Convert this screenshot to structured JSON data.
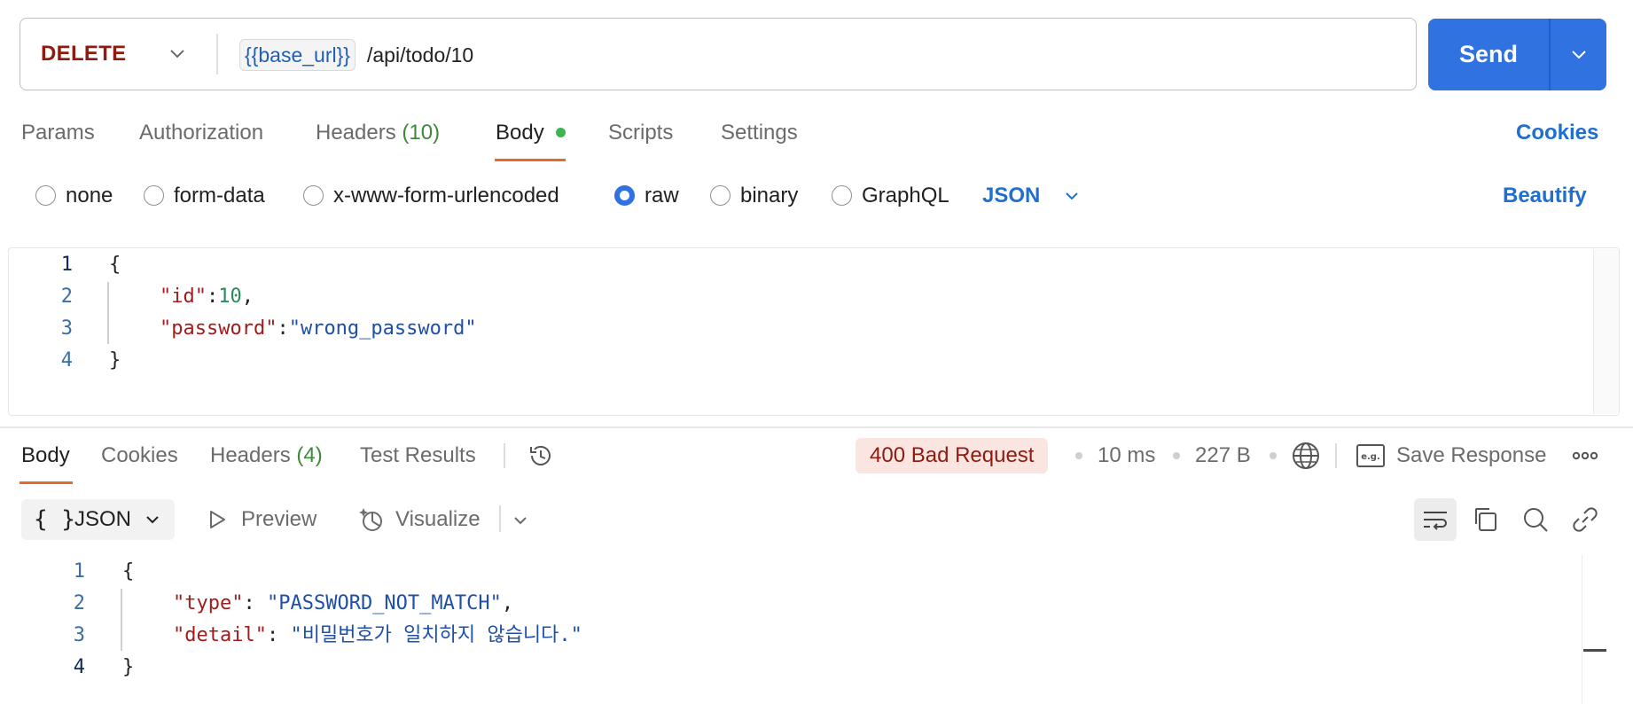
{
  "request": {
    "method": "DELETE",
    "url_variable": "{{base_url}}",
    "url_path": "/api/todo/10",
    "send_label": "Send"
  },
  "request_tabs": [
    {
      "label": "Params"
    },
    {
      "label": "Authorization"
    },
    {
      "label": "Headers",
      "count": "(10)"
    },
    {
      "label": "Body"
    },
    {
      "label": "Scripts"
    },
    {
      "label": "Settings"
    }
  ],
  "cookies_label": "Cookies",
  "body_types": [
    {
      "label": "none",
      "selected": false
    },
    {
      "label": "form-data",
      "selected": false
    },
    {
      "label": "x-www-form-urlencoded",
      "selected": false
    },
    {
      "label": "raw",
      "selected": true
    },
    {
      "label": "binary",
      "selected": false
    },
    {
      "label": "GraphQL",
      "selected": false
    }
  ],
  "raw_format": "JSON",
  "beautify_label": "Beautify",
  "request_body": {
    "line_numbers": [
      "1",
      "2",
      "3",
      "4"
    ],
    "open": "{",
    "close": "}",
    "id_key": "\"id\"",
    "id_value": "10",
    "password_key": "\"password\"",
    "password_value": "\"wrong_password\""
  },
  "response_tabs": [
    {
      "label": "Body"
    },
    {
      "label": "Cookies"
    },
    {
      "label": "Headers",
      "count": "(4)"
    },
    {
      "label": "Test Results"
    }
  ],
  "response_meta": {
    "status": "400 Bad Request",
    "status_color": "#8e1a10",
    "time": "10 ms",
    "size": "227 B",
    "save_label": "Save Response"
  },
  "response_toolbar": {
    "format_braces": "{ }",
    "format": "JSON",
    "preview_label": "Preview",
    "visualize_label": "Visualize"
  },
  "response_body": {
    "line_numbers": [
      "1",
      "2",
      "3",
      "4"
    ],
    "open": "{",
    "close": "}",
    "type_key": "\"type\"",
    "type_value": "\"PASSWORD_NOT_MATCH\"",
    "detail_key": "\"detail\"",
    "detail_value": "\"비밀번호가 일치하지 않습니다.\""
  },
  "colors": {
    "accent": "#2f72e0",
    "tab_underline": "#e8692c",
    "method": "#8e1a10",
    "link": "#1f6fd0"
  }
}
